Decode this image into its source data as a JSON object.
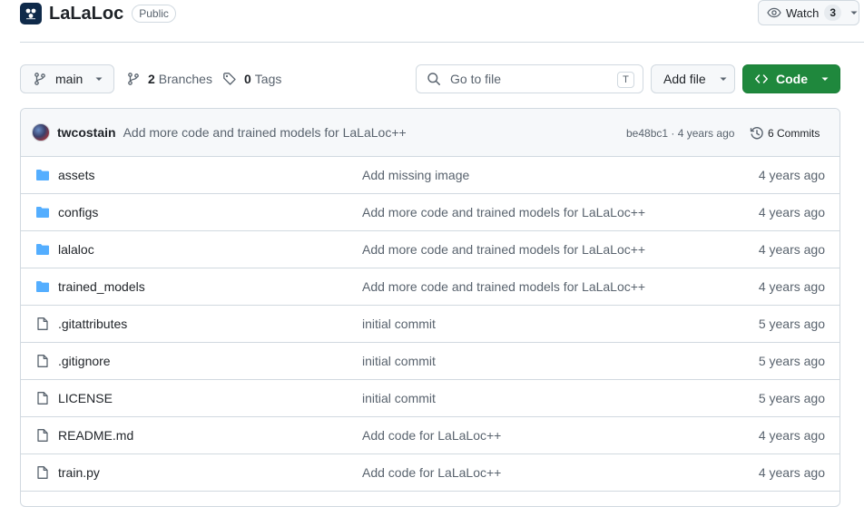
{
  "repo": {
    "name": "LaLaLoc",
    "visibility": "Public",
    "watch_label": "Watch",
    "watch_count": "3"
  },
  "toolbar": {
    "branch": "main",
    "branches_count": "2",
    "branches_label": "Branches",
    "tags_count": "0",
    "tags_label": "Tags",
    "goto_placeholder": "Go to file",
    "goto_shortcut": "T",
    "add_file_label": "Add file",
    "code_label": "Code"
  },
  "commit": {
    "author": "twcostain",
    "message": "Add more code and trained models for LaLaLoc++",
    "sha_time": "be48bc1 · 4 years ago",
    "commits_label": "6 Commits"
  },
  "files": [
    {
      "name": "assets",
      "type": "folder",
      "message": "Add missing image",
      "date": "4 years ago"
    },
    {
      "name": "configs",
      "type": "folder",
      "message": "Add more code and trained models for LaLaLoc++",
      "date": "4 years ago"
    },
    {
      "name": "lalaloc",
      "type": "folder",
      "message": "Add more code and trained models for LaLaLoc++",
      "date": "4 years ago"
    },
    {
      "name": "trained_models",
      "type": "folder",
      "message": "Add more code and trained models for LaLaLoc++",
      "date": "4 years ago"
    },
    {
      "name": ".gitattributes",
      "type": "file",
      "message": "initial commit",
      "date": "5 years ago"
    },
    {
      "name": ".gitignore",
      "type": "file",
      "message": "initial commit",
      "date": "5 years ago"
    },
    {
      "name": "LICENSE",
      "type": "file",
      "message": "initial commit",
      "date": "5 years ago"
    },
    {
      "name": "README.md",
      "type": "file",
      "message": "Add code for LaLaLoc++",
      "date": "4 years ago"
    },
    {
      "name": "train.py",
      "type": "file",
      "message": "Add code for LaLaLoc++",
      "date": "4 years ago"
    }
  ],
  "colors": {
    "folder_icon": "#54aeff",
    "code_button": "#1f883d",
    "border": "#d1d9e0",
    "muted_text": "#59636e"
  }
}
